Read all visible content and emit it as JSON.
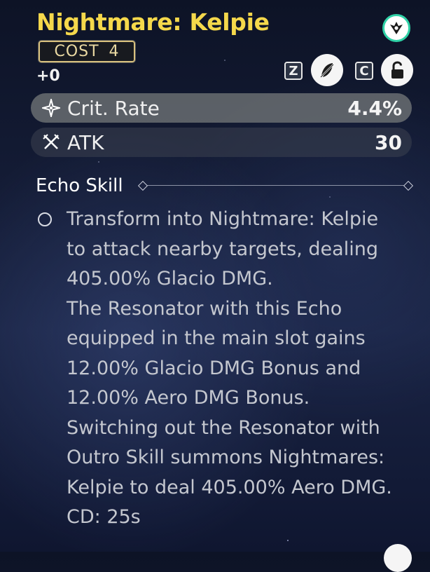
{
  "echo": {
    "name": "Nightmare: Kelpie",
    "cost_label": "COST",
    "cost_value": "4",
    "level": "+0"
  },
  "sonata_icon": "sonata-set-emblem",
  "controls": {
    "discard_key": "Z",
    "lock_key": "C",
    "discard_icon": "discard-feather-icon",
    "lock_icon": "unlocked-padlock-icon"
  },
  "main_stat": {
    "name": "Crit. Rate",
    "value": "4.4%",
    "icon": "sparkle-icon"
  },
  "sub_stat": {
    "name": "ATK",
    "value": "30",
    "icon": "crossed-swords-icon"
  },
  "skill": {
    "heading": "Echo Skill",
    "lines": [
      "Transform into Nightmare: Kelpie",
      "to attack nearby targets, dealing",
      "405.00% Glacio DMG.",
      "The Resonator with this Echo",
      "equipped in the main slot gains",
      "12.00% Glacio DMG Bonus and",
      "12.00% Aero DMG Bonus.",
      "Switching out the Resonator with",
      "Outro Skill summons Nightmares:",
      "Kelpie to deal 405.00% Aero DMG.",
      "CD: 25s"
    ]
  },
  "colors": {
    "title": "#f5d84b",
    "sonata_ring": "#2fd1a6",
    "cost_border": "#d8c17e",
    "main_stat_bg": "#7d8282"
  }
}
